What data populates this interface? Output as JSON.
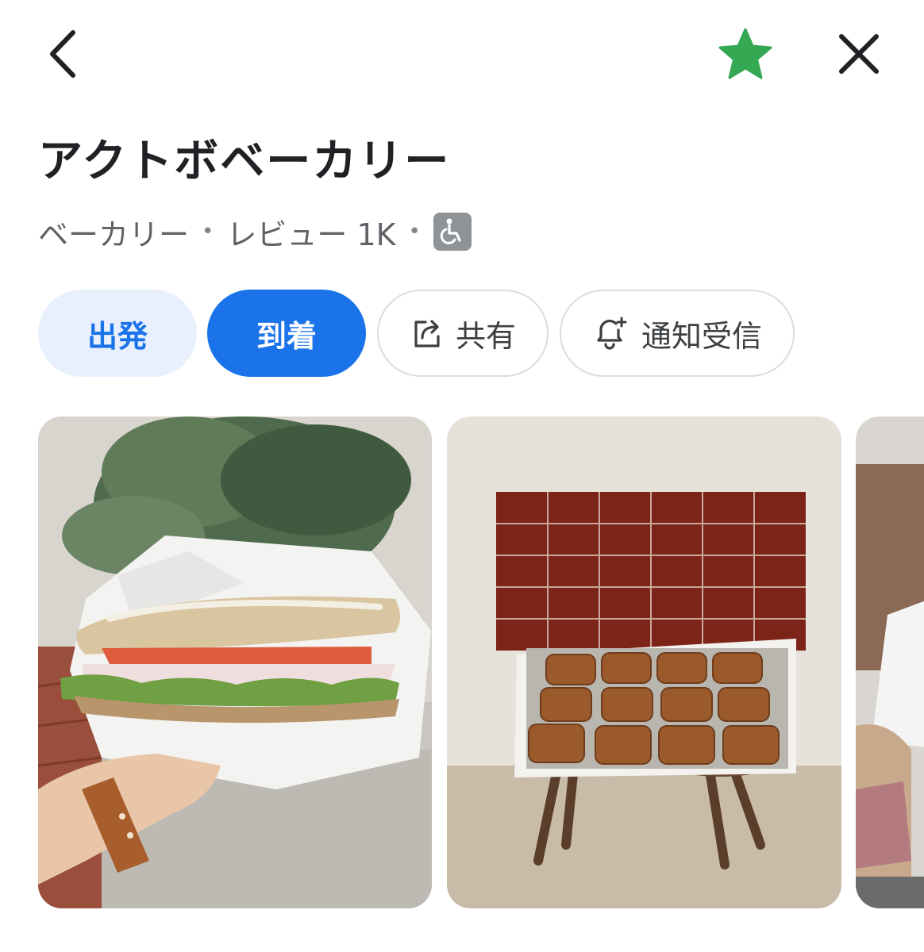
{
  "header": {
    "icons": [
      "chevron-left-icon",
      "star-icon",
      "close-icon"
    ],
    "star_color": "#34a853"
  },
  "place": {
    "name": "アクトボベーカリー",
    "category": "ベーカリー",
    "separator": "•",
    "reviews": "レビュー 1K",
    "accessibility_icon": "wheelchair-icon"
  },
  "actions": {
    "depart_label": "出発",
    "arrive_label": "到着",
    "share_label": "共有",
    "notify_label": "通知受信"
  },
  "photos": [
    {
      "subject": "sandwich-photo"
    },
    {
      "subject": "pastries-tray-photo"
    },
    {
      "subject": "food-photo-partial"
    }
  ],
  "colors": {
    "accent": "#1a73e8",
    "accent_light": "#e8f0fe",
    "text_primary": "#202124",
    "text_secondary": "#5f6368"
  }
}
